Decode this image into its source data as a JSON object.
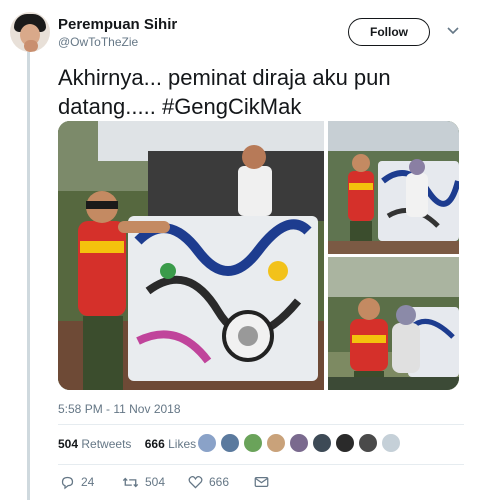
{
  "user": {
    "display_name": "Perempuan Sihir",
    "handle": "@OwToTheZie"
  },
  "follow_label": "Follow",
  "tweet": {
    "text": "Akhirnya... peminat diraja aku pun datang..... #GengCikMak"
  },
  "timestamp": "5:58 PM - 11 Nov 2018",
  "stats": {
    "retweets_count": "504",
    "retweets_label": "Retweets",
    "likes_count": "666",
    "likes_label": "Likes"
  },
  "actions": {
    "reply_count": "24",
    "retweet_count": "504",
    "like_count": "666"
  },
  "colors": {
    "text": "#14171a",
    "muted": "#657786",
    "divider": "#e6ecf0"
  },
  "icons": [
    "caret-down-icon",
    "reply-icon",
    "retweet-icon",
    "heart-icon",
    "message-icon"
  ]
}
